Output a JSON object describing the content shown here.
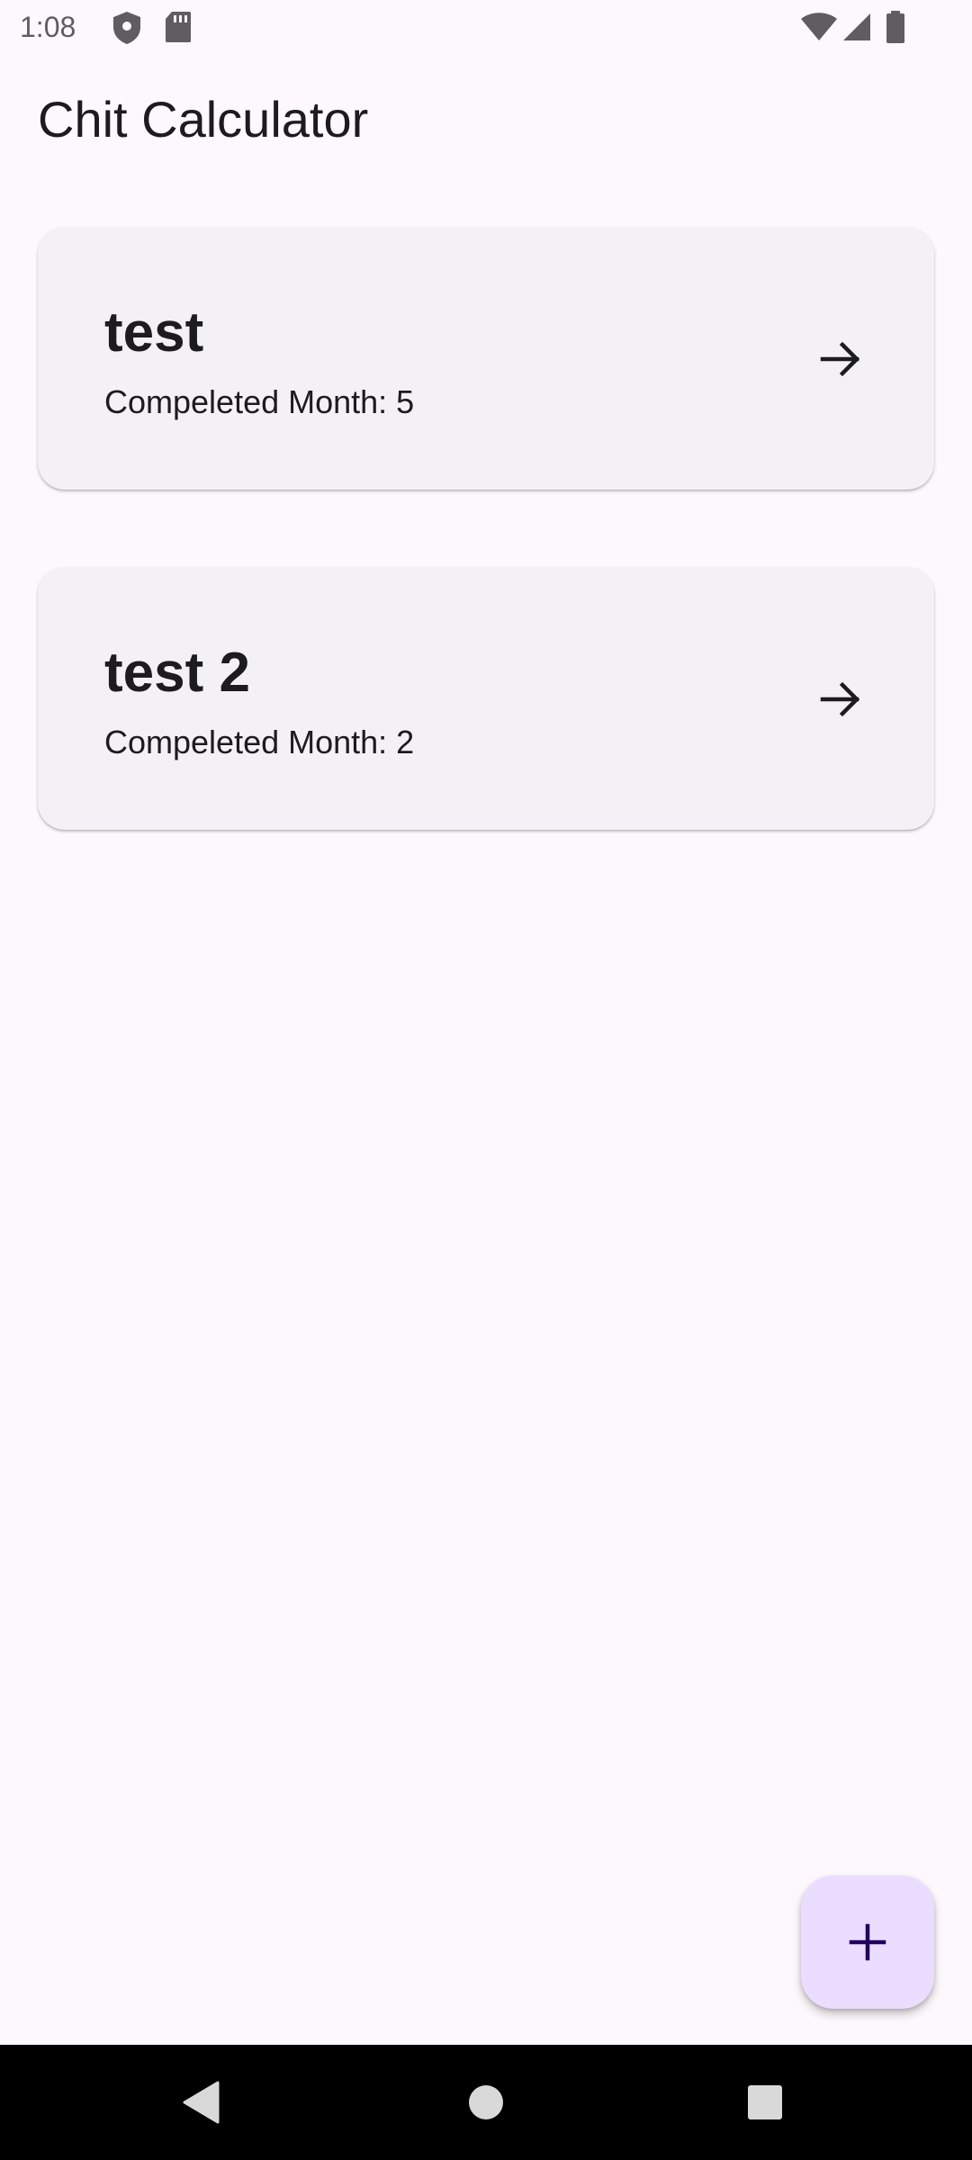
{
  "status_bar": {
    "time": "1:08",
    "icons": [
      "shield-icon",
      "sd-card-icon",
      "wifi-icon",
      "cell-signal-icon",
      "battery-icon"
    ]
  },
  "app_bar": {
    "title": "Chit Calculator"
  },
  "chits": [
    {
      "name": "test",
      "completed_label": "Compeleted Month: 5"
    },
    {
      "name": "test 2",
      "completed_label": "Compeleted Month: 2"
    }
  ],
  "fab": {
    "icon": "plus-icon"
  },
  "nav_bar": {
    "buttons": [
      "back-icon",
      "home-icon",
      "recents-icon"
    ]
  },
  "colors": {
    "background": "#FDF8FC",
    "card": "#F4F1F6",
    "fab": "#EADDFF",
    "fab_icon": "#21005D",
    "text": "#1C1B1F",
    "nav_bar": "#000000"
  }
}
